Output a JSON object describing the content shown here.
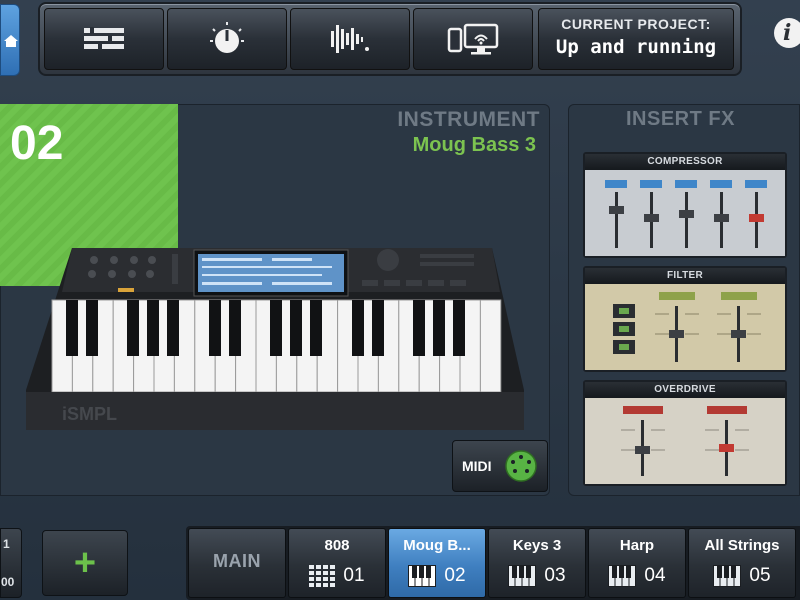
{
  "toolbar": {
    "buttons": [
      {
        "icon": "mixer-icon"
      },
      {
        "icon": "knob-icon"
      },
      {
        "icon": "waveform-icon"
      },
      {
        "icon": "devices-wifi-icon"
      }
    ],
    "project_label": "CURRENT PROJECT:",
    "project_name": "Up and running",
    "info_label": "i"
  },
  "instrument": {
    "track_number": "02",
    "heading": "INSTRUMENT",
    "name": "Moug Bass 3",
    "keyboard_brand": "iSMPL",
    "midi_label": "MIDI"
  },
  "insert_fx": {
    "title": "INSERT FX",
    "units": [
      {
        "name": "COMPRESSOR"
      },
      {
        "name": "FILTER"
      },
      {
        "name": "OVERDRIVE"
      }
    ]
  },
  "bottom_left": {
    "line1": "1",
    "line2": "00"
  },
  "add_button": {
    "label": "+"
  },
  "tracks": [
    {
      "name": "MAIN",
      "number": "",
      "active": false
    },
    {
      "name": "808",
      "number": "01",
      "active": false
    },
    {
      "name": "Moug B...",
      "number": "02",
      "active": true
    },
    {
      "name": "Keys 3",
      "number": "03",
      "active": false
    },
    {
      "name": "Harp",
      "number": "04",
      "active": false
    },
    {
      "name": "All Strings",
      "number": "05",
      "active": false
    }
  ],
  "colors": {
    "accent_green": "#6fc34e",
    "active_blue": "#4a8ccc",
    "instrument_name_green": "#7cc350"
  }
}
